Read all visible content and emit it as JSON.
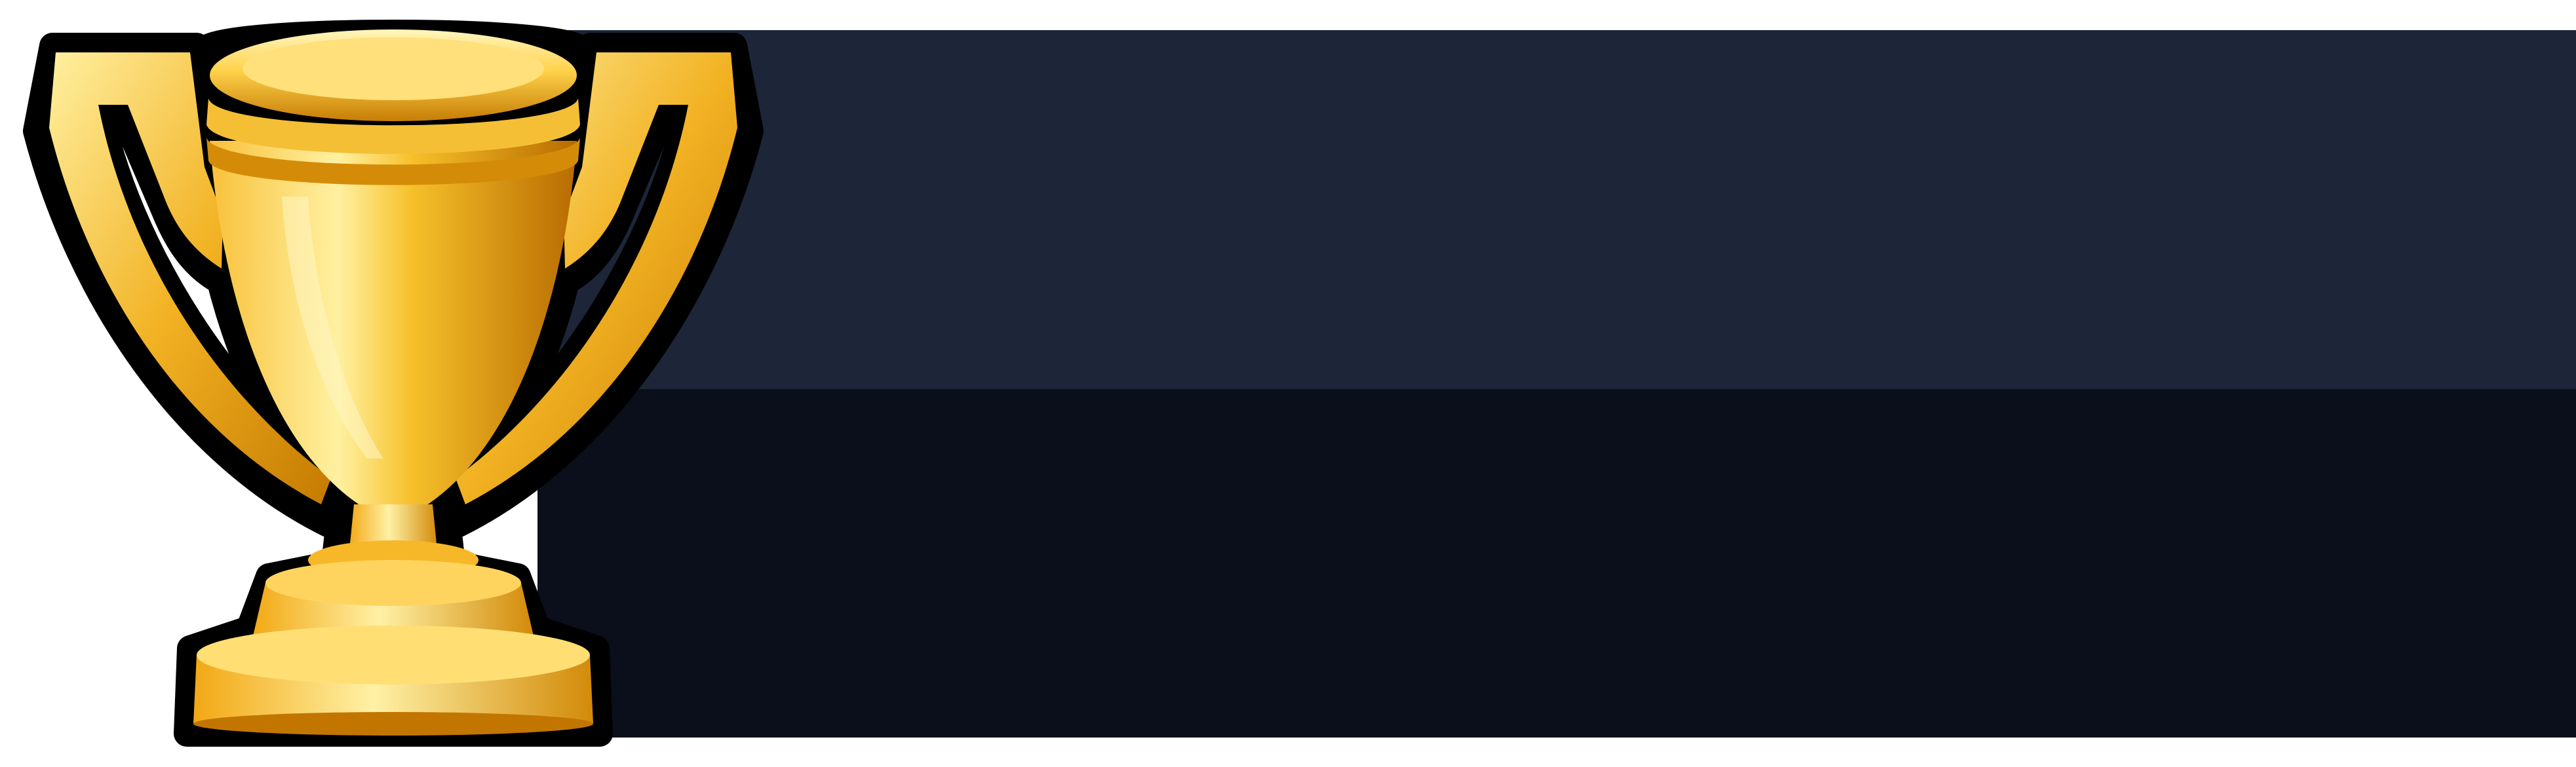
{
  "colors": {
    "background": "#ffffff",
    "panel_top": "#1c2638",
    "panel_bottom": "#0a0f1b",
    "trophy_gold_light": "#fff3a0",
    "trophy_gold": "#f4b323",
    "trophy_gold_dark": "#b86c00",
    "trophy_outline": "#000000"
  },
  "icons": {
    "trophy": "trophy-icon"
  }
}
